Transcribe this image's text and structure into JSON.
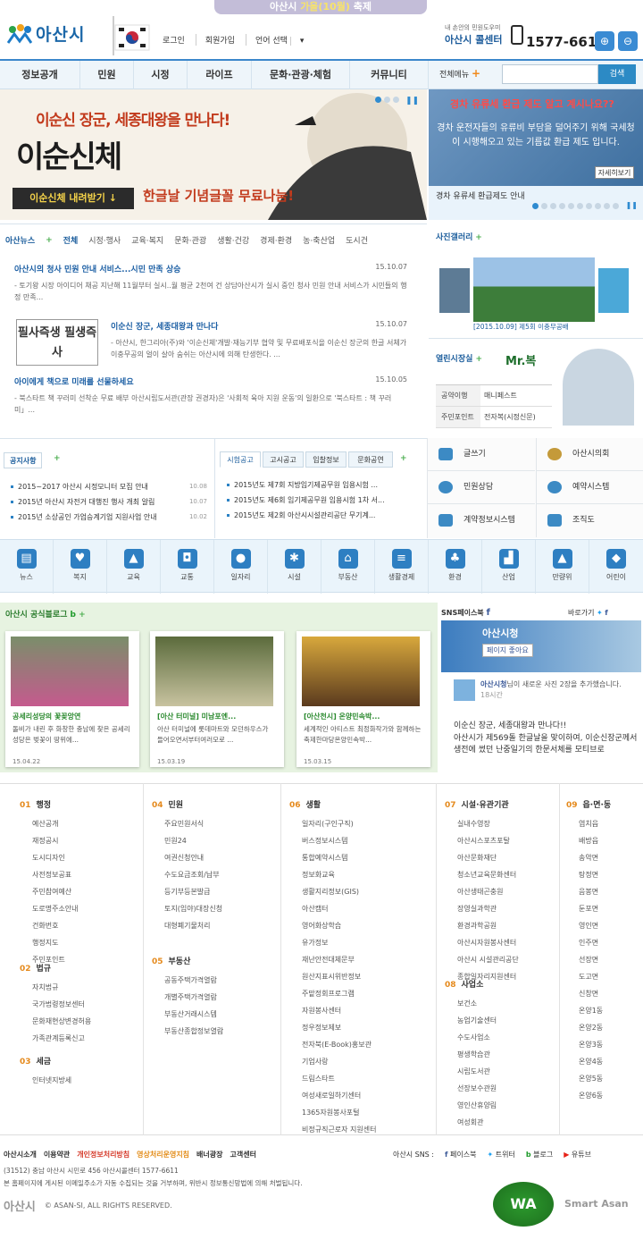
{
  "top_banner": {
    "prefix": "아산시 ",
    "accent": "가을(10월)",
    "suffix": " 축제"
  },
  "logo": {
    "text": "아산시"
  },
  "util": [
    "로그인",
    "회원가입",
    "언어 선택"
  ],
  "call": {
    "small": "내 손안의 민원도우미",
    "label": "아산시 콜센터",
    "number": "1577-6611"
  },
  "nav": [
    "정보공개",
    "민원",
    "시정",
    "라이프",
    "문화·관광·체험",
    "커뮤니티"
  ],
  "all_menu": "전체메뉴",
  "search": {
    "button": "검색"
  },
  "hero": {
    "line1": "이순신 장군, 세종대왕을 만나다!",
    "line2": "이순신체",
    "line3": "한글날 기념글꼴 무료나눔!",
    "download": "이순신체 내려받기 ↓"
  },
  "side_banner": {
    "head": "경차 유류세 환급 제도 알고 계시나요??",
    "body": "경차 운전자들의 유류비 부담을 덜어주기 위해 국세청이 시행해오고 있는 기름값 환급 제도 입니다.",
    "more": "자세히보기",
    "caption": "경차 유류세 환급제도 안내"
  },
  "news_tabs": {
    "title": "아산뉴스",
    "items": [
      "전체",
      "시정·행사",
      "교육·복지",
      "문화·관광",
      "생활·건강",
      "경제·환경",
      "농·축산업",
      "도시건"
    ]
  },
  "news": [
    {
      "title": "아산시의 청사 민원 안내 서비스...시민 만족 상승",
      "date": "15.10.07",
      "desc": "- 토기왕 시장 아이디어 채공 지난해 11월부터 실시..월 평균 2천여 건 상담아산시가 실시 중인 청사 민원 안내 서비스가 시민들의 행정 만족..."
    },
    {
      "title": "이순신 장군, 세종대왕과 만나다",
      "date": "15.10.07",
      "desc": "- 아산시, 한그리아(주)와 '이순신체'개발·재능기부 협약 및 무료배포식을 이순신 장군의 한글 서체가 이충무공의 얼이 살아 숨쉬는 아산시에 의해 탄생한다. ..."
    },
    {
      "title": "아이에게 책으로 미래를 선물하세요",
      "date": "15.10.05",
      "desc": "- 북스타트 책 꾸러미 선착순 무료 배부 아산시립도서관(관장 권경자)은 '사회적 육아 지원 운동'의 일환으로 '북스타트 : 책 꾸러미」..."
    }
  ],
  "news_thumb": "필사즉생 필생즉사",
  "gallery": {
    "title": "사진갤러리",
    "caption": "[2015.10.09] 제5회 이충무공배"
  },
  "mayor": {
    "title": "열린시장실",
    "brand": "Mr.복",
    "rows": [
      [
        "공약이행",
        "매니페스트"
      ],
      [
        "주민포인트",
        "전자복(시정신문)"
      ]
    ]
  },
  "notice": {
    "title": "공지사항",
    "items": [
      [
        "2015~2017 아산시 시정모니터 모집 안내",
        "10.08"
      ],
      [
        "2015년 아산시 자전거 대행진 행사 개최 알림",
        "10.07"
      ],
      [
        "2015년 소상공인 가업승계기업 지원사업 안내",
        "10.02"
      ]
    ]
  },
  "recruit": {
    "tabs": [
      "시험공고",
      "고시공고",
      "입찰정보",
      "문화공연"
    ],
    "items": [
      "2015년도 제7회 지방임기제공무원 임용시험 ...",
      "2015년도 제6회 임기제공무원 임용시험 1차 서...",
      "2015년도 제2회 아산시시설관리공단 무기계..."
    ]
  },
  "quick": [
    "글쓰기",
    "아산시의회",
    "민원상담",
    "예약시스템",
    "계약정보시스템",
    "조직도"
  ],
  "icons": [
    "뉴스",
    "복지",
    "교육",
    "교통",
    "일자리",
    "시설",
    "부동산",
    "생활경제",
    "환경",
    "산업",
    "만량위",
    "어린이"
  ],
  "blog": {
    "title": "아산시 공식블로그",
    "cards": [
      {
        "title": "공세리성당의 꽃꽂앙연",
        "text": "돌비가 내린 후 화창한 충남에 찾은 공세리 성당은 벚꽃이 땅위에...",
        "date": "15.04.22"
      },
      {
        "title": "[아산 터미널] 미남포엔...",
        "text": "아산 터미널에 롯데마트와 모던하우스가 들어오면서부터여러모로 ...",
        "date": "15.03.19"
      },
      {
        "title": "[아산천시] 온양민속박...",
        "text": "세계적인 아티스트 최정화작가와 함께하는 축제한마당온양민속박...",
        "date": "15.03.15"
      }
    ]
  },
  "facebook": {
    "title": "SNS페이스북",
    "shortcut": "바로가기",
    "page": "아산시청",
    "like": "페이지 좋아요",
    "name": "아산시청",
    "post": "님이 새로운 사진 2장을 추가했습니다.",
    "time": "18시간",
    "headline": "이순신 장군, 세종대왕과 만나다!!",
    "text": "아산시가 제569돌 한글날을 맞이하여, 이순신장군께서 생전에 썼던 난중일기의 한문서체를 모티브로"
  },
  "sitemap": [
    {
      "no": "01",
      "head": "행정",
      "items": [
        "예산공개",
        "재정공시",
        "도시디자인",
        "사전정보공표",
        "주민참여예산",
        "도로명주소안내",
        "건화번호",
        "행정지도",
        "주민포인트"
      ]
    },
    {
      "no": "02",
      "head": "법규",
      "items": [
        "자치법규",
        "국가법령정보센터",
        "문화재현상변경허용",
        "가족관계등록신고"
      ]
    },
    {
      "no": "03",
      "head": "세금",
      "items": [
        "인터넷지방세"
      ]
    },
    {
      "no": "04",
      "head": "민원",
      "items": [
        "주요민원서식",
        "민원24",
        "여권신청안내",
        "수도요금조회/납부",
        "등기부등본발급",
        "토지(임야)대장신청",
        "대형폐기물처리"
      ]
    },
    {
      "no": "05",
      "head": "부동산",
      "items": [
        "공동주택가격열람",
        "개별주택가격열람",
        "부동산거래시스템",
        "부동산종합정보열람"
      ]
    },
    {
      "no": "06",
      "head": "생활",
      "items": [
        "일자리(구인구직)",
        "버스정보시스템",
        "통합예약시스템",
        "정보화교육",
        "생활지리정보(GIS)",
        "아산캠터",
        "영어화상학습",
        "유가정보",
        "재난안전대체문부",
        "원산지표시위반정보",
        "주맡정회프로그램",
        "자원봉사센터",
        "정우정보제보",
        "전자북(E-Book)홍보관",
        "기업사랑",
        "드림스타트",
        "여성새로일하기센터",
        "1365자원봉사포털",
        "비정규직근로자 지원센터"
      ]
    },
    {
      "no": "07",
      "head": "시설·유관기관",
      "items": [
        "실내수영장",
        "아산시스포츠포탈",
        "아산문화재단",
        "청소년교육문화센터",
        "아산생태곤충원",
        "장영실과학관",
        "환경과학공원",
        "아산시자원봉사센터",
        "아산시 시설관리공단",
        "종합일자리지원센터"
      ]
    },
    {
      "no": "08",
      "head": "사업소",
      "items": [
        "보건소",
        "농업기술센터",
        "수도사업소",
        "평생학습관",
        "시립도서관",
        "선장보수관원",
        "영인산휴양림",
        "여성회관"
      ]
    },
    {
      "no": "09",
      "head": "읍·면·동",
      "items": [
        "염치읍",
        "배방읍",
        "송악면",
        "탕정면",
        "음봉면",
        "둔포면",
        "영인면",
        "인주면",
        "선장면",
        "도고면",
        "신창면",
        "온양1동",
        "온양2동",
        "온양3동",
        "온양4동",
        "온양5동",
        "온양6동"
      ]
    }
  ],
  "footer": {
    "links": [
      "아산시소개",
      "이용약관",
      "개인정보처리방침",
      "영상처리운영지침",
      "배너광장",
      "고객센터"
    ],
    "sns_label": "아산시 SNS :",
    "sns": [
      "페이스북",
      "트위터",
      "블로그",
      "유튜브"
    ],
    "address": "(31512) 충남 아산시 시민로 456          아산시콜센터 1577-6611",
    "notice": "본 홈페이지에 게시된 이메일주소가 자동 수집되는 것을 거부하며, 위반시 정보통신망법에 의해 처벌됩니다.",
    "logo": "아산시",
    "copyright": "© ASAN-SI, ALL RIGHTS RESERVED.",
    "wa": "WA",
    "smart": "Smart Asan"
  }
}
